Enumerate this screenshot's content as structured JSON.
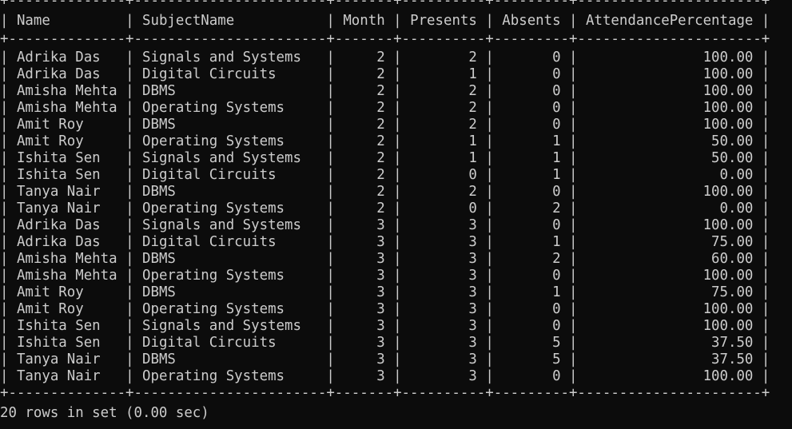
{
  "terminal": {
    "top_border_partial": "+--------------+-----------------------+-------+----------+---------+----------------------+",
    "separator": "+--------------+-----------------------+-------+----------+---------+----------------------+"
  },
  "table": {
    "columns": [
      "Name",
      "SubjectName",
      "Month",
      "Presents",
      "Absents",
      "AttendancePercentage"
    ],
    "rows": [
      [
        "Adrika Das",
        "Signals and Systems",
        "2",
        "2",
        "0",
        "100.00"
      ],
      [
        "Adrika Das",
        "Digital Circuits",
        "2",
        "1",
        "0",
        "100.00"
      ],
      [
        "Amisha Mehta",
        "DBMS",
        "2",
        "2",
        "0",
        "100.00"
      ],
      [
        "Amisha Mehta",
        "Operating Systems",
        "2",
        "2",
        "0",
        "100.00"
      ],
      [
        "Amit Roy",
        "DBMS",
        "2",
        "2",
        "0",
        "100.00"
      ],
      [
        "Amit Roy",
        "Operating Systems",
        "2",
        "1",
        "1",
        "50.00"
      ],
      [
        "Ishita Sen",
        "Signals and Systems",
        "2",
        "1",
        "1",
        "50.00"
      ],
      [
        "Ishita Sen",
        "Digital Circuits",
        "2",
        "0",
        "1",
        "0.00"
      ],
      [
        "Tanya Nair",
        "DBMS",
        "2",
        "2",
        "0",
        "100.00"
      ],
      [
        "Tanya Nair",
        "Operating Systems",
        "2",
        "0",
        "2",
        "0.00"
      ],
      [
        "Adrika Das",
        "Signals and Systems",
        "3",
        "3",
        "0",
        "100.00"
      ],
      [
        "Adrika Das",
        "Digital Circuits",
        "3",
        "3",
        "1",
        "75.00"
      ],
      [
        "Amisha Mehta",
        "DBMS",
        "3",
        "3",
        "2",
        "60.00"
      ],
      [
        "Amisha Mehta",
        "Operating Systems",
        "3",
        "3",
        "0",
        "100.00"
      ],
      [
        "Amit Roy",
        "DBMS",
        "3",
        "3",
        "1",
        "75.00"
      ],
      [
        "Amit Roy",
        "Operating Systems",
        "3",
        "3",
        "0",
        "100.00"
      ],
      [
        "Ishita Sen",
        "Signals and Systems",
        "3",
        "3",
        "0",
        "100.00"
      ],
      [
        "Ishita Sen",
        "Digital Circuits",
        "3",
        "3",
        "5",
        "37.50"
      ],
      [
        "Tanya Nair",
        "DBMS",
        "3",
        "3",
        "5",
        "37.50"
      ],
      [
        "Tanya Nair",
        "Operating Systems",
        "3",
        "3",
        "0",
        "100.00"
      ]
    ]
  },
  "status": {
    "text": "20 rows in set (0.00 sec)"
  },
  "colors": {
    "background": "#0c0c0c",
    "foreground": "#cccccc"
  }
}
